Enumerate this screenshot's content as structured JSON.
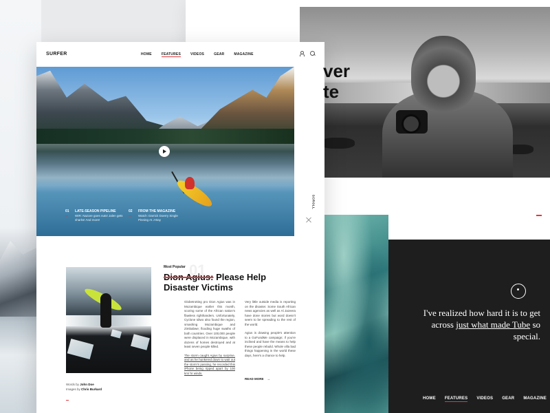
{
  "main": {
    "logo": "SURFER",
    "nav": [
      "HOME",
      "FEATURES",
      "VIDEOS",
      "GEAR",
      "MAGAZINE"
    ],
    "active_nav": "FEATURES",
    "hero_items": [
      {
        "num": "01",
        "title": "LATE-SEASON PIPELINE",
        "desc": "WIR: Nazare goes nuts! Jalen gets sharks! And more!"
      },
      {
        "num": "02",
        "title": "FROM THE MAGAZINE",
        "desc": "Watch: Darrick Doerry Single Pinning At J-Bay"
      }
    ],
    "scroll_label": "SCROLL",
    "article": {
      "eyebrow": "Most Popular",
      "number": "01",
      "headline_struck": "Dion Agius:",
      "headline_rest": " Please Help Disaster Victims",
      "col1": [
        "Globetrotting pro Dion Agius was in Mozambique earlier this month, scoring some of the African nation's flawless righthanders. Unfortunately, Cyclone Idiwo also found the region, smashing Mozambique and Zimbabwe; flooding huge swaths of both countries. Over 100,000 people were displaced in Mozambique, with dozens of homes destroyed and at least seven people killed.",
        "The storm caught Agius by surprise, and as he hunkered down to wait out the storm's passing, he recorded this iPhone being ripped apart by 100 km/ hr winds."
      ],
      "col2": [
        "Very little outside media is reporting on the disaster. Some South African news agencies as well as Al Jazeera have done stories but word doesn't seem to be spreading to the rest of the world.",
        "Agius is drawing people's attention to a GoFundMe campaign; if you're inclined and have the means to help these people rebuild. Whole villa bad things happening in the world these days, here's a chance to help."
      ],
      "read_more": "READ MORE",
      "read_more_arrow": "→",
      "credit_words_label": "Words by",
      "credit_words_name": "John Doe",
      "credit_images_label": "Images by",
      "credit_images_name": "Chris Burkard"
    }
  },
  "back": {
    "headline_line1": "ver",
    "headline_line2": "te",
    "quote_pre": "I've realized how hard it is to get across ",
    "quote_link": "just what made Tube",
    "quote_post": " so special.",
    "nav": [
      "HOME",
      "FEATURES",
      "VIDEOS",
      "GEAR",
      "MAGAZINE"
    ],
    "active_nav": "FEATURES"
  },
  "colors": {
    "accent": "#e0393e",
    "dark_panel": "#1e1e1f",
    "page_bg": "#e9eaec"
  },
  "icons": [
    "user-icon",
    "search-icon",
    "play-icon",
    "close-icon",
    "arrow-right-icon"
  ]
}
